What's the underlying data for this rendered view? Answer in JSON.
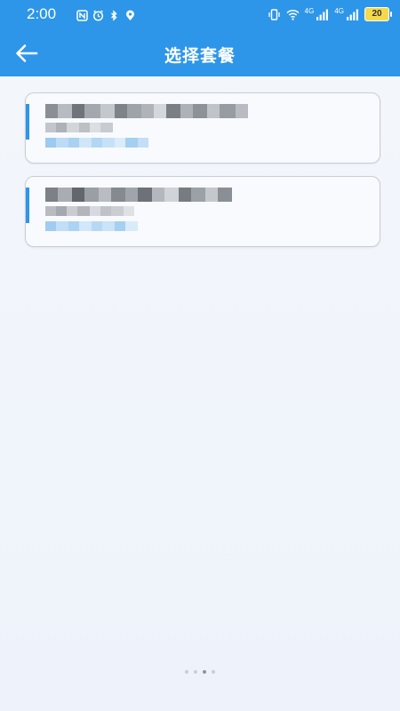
{
  "status_bar": {
    "time": "2:00",
    "left_icons": [
      "nfc-icon",
      "alarm-icon",
      "bluetooth-icon",
      "location-icon"
    ],
    "right_icons": [
      "vibrate-icon",
      "wifi-icon",
      "signal-sim1-icon",
      "signal-sim2-icon"
    ],
    "network_1": "4G",
    "network_2": "4G",
    "battery_level": "20"
  },
  "header": {
    "title": "选择套餐",
    "back_icon": "arrow-left-icon"
  },
  "plans": [
    {
      "name": "",
      "detail": "",
      "price": ""
    },
    {
      "name": "",
      "detail": "",
      "price": ""
    }
  ],
  "pager": {
    "total": 4,
    "active": 2
  },
  "colors": {
    "brand_blue": "#2d96e8",
    "background": "#f2f5fb",
    "card_border": "#c8cdd6",
    "battery_fill": "#f6d94b"
  }
}
